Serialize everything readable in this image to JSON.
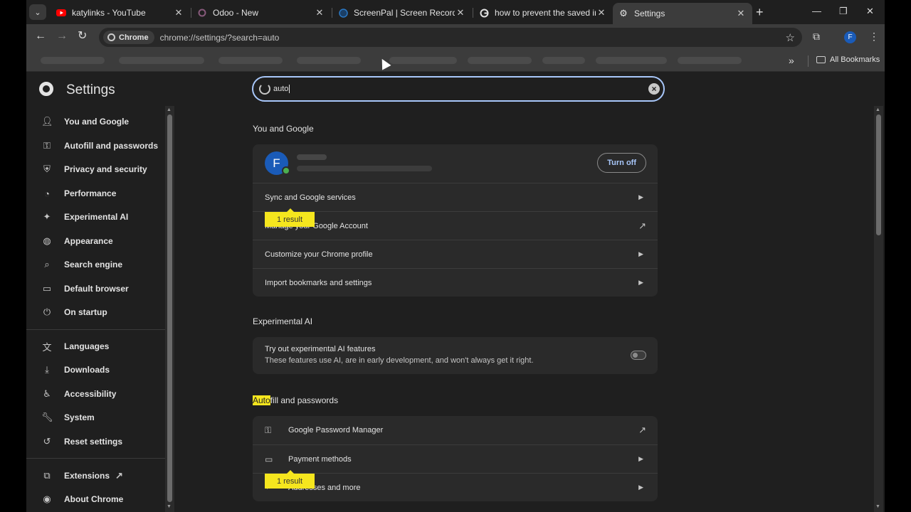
{
  "tabs": [
    {
      "title": "katylinks - YouTube",
      "close": "✕",
      "favicon": "youtube-icon",
      "favicon_color": "#ff0000"
    },
    {
      "title": "Odoo - New",
      "close": "✕",
      "favicon": "odoo-icon",
      "favicon_color": "#875a7b"
    },
    {
      "title": "ScreenPal | Screen Recorder &",
      "close": "✕",
      "favicon": "screenpal-icon",
      "favicon_color": "#2a78c4"
    },
    {
      "title": "how to prevent the saved infor",
      "close": "✕",
      "favicon": "google-icon",
      "favicon_color": "#e3e3e3"
    },
    {
      "title": "Settings",
      "close": "✕",
      "favicon": "settings-gear-icon",
      "favicon_color": "#e3e3e3"
    }
  ],
  "toolbar": {
    "chip_label": "Chrome",
    "url": "chrome://settings/?search=auto",
    "profile_initial": "F"
  },
  "bookmarks": {
    "all_label": "All Bookmarks"
  },
  "settings": {
    "title": "Settings",
    "search_query": "auto",
    "nav": [
      {
        "label": "You and Google",
        "icon": "person-icon"
      },
      {
        "label": "Autofill and passwords",
        "icon": "key-icon"
      },
      {
        "label": "Privacy and security",
        "icon": "shield-icon"
      },
      {
        "label": "Performance",
        "icon": "speedometer-icon"
      },
      {
        "label": "Experimental AI",
        "icon": "sparkle-icon"
      },
      {
        "label": "Appearance",
        "icon": "palette-icon"
      },
      {
        "label": "Search engine",
        "icon": "search-icon"
      },
      {
        "label": "Default browser",
        "icon": "browser-icon"
      },
      {
        "label": "On startup",
        "icon": "power-icon"
      },
      {
        "label": "Languages",
        "icon": "translate-icon"
      },
      {
        "label": "Downloads",
        "icon": "download-icon"
      },
      {
        "label": "Accessibility",
        "icon": "accessibility-icon"
      },
      {
        "label": "System",
        "icon": "wrench-icon"
      },
      {
        "label": "Reset settings",
        "icon": "reset-icon"
      },
      {
        "label": "Extensions",
        "icon": "puzzle-icon"
      },
      {
        "label": "About Chrome",
        "icon": "chrome-icon"
      }
    ],
    "you_and_google": {
      "section_title": "You and Google",
      "avatar_initial": "F",
      "turn_off_label": "Turn off",
      "rows": [
        "Sync and Google services",
        "Manage your Google Account",
        "Customize your Chrome profile",
        "Import bookmarks and settings"
      ]
    },
    "experimental_ai": {
      "section_title": "Experimental AI",
      "row_title": "Try out experimental AI features",
      "row_desc": "These features use AI, are in early development, and won't always get it right.",
      "toggle_on": false
    },
    "autofill": {
      "section_title_highlight": "Auto",
      "section_title_rest": "fill and passwords",
      "rows": [
        {
          "label": "Google Password Manager",
          "icon": "key-icon"
        },
        {
          "label": "Payment methods",
          "icon": "credit-card-icon"
        },
        {
          "label": "Addresses and more",
          "icon": "location-pin-icon"
        }
      ]
    },
    "result_bubble": "1 result"
  }
}
